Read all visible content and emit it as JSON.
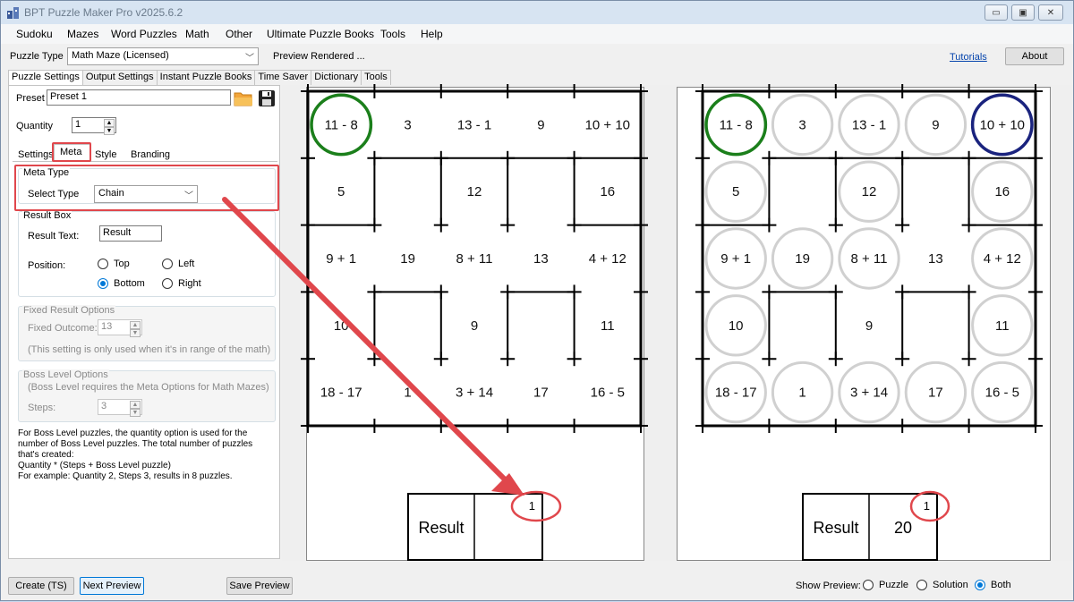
{
  "window": {
    "title": "BPT Puzzle Maker Pro v2025.6.2",
    "min": "▭",
    "max": "▣",
    "close": "✕"
  },
  "menu": [
    "Sudoku",
    "Mazes",
    "Word Puzzles",
    "Math",
    "Other",
    "Ultimate Puzzle Books",
    "Tools",
    "Help"
  ],
  "puzzle_type": {
    "label": "Puzzle Type",
    "value": "Math Maze (Licensed)",
    "status": "Preview Rendered ...",
    "tutorials": "Tutorials",
    "about": "About"
  },
  "main_tabs": [
    "Puzzle Settings",
    "Output Settings",
    "Instant Puzzle Books",
    "Time Saver",
    "Dictionary",
    "Tools"
  ],
  "preset": {
    "label": "Preset",
    "value": "Preset 1"
  },
  "quantity": {
    "label": "Quantity",
    "value": "1"
  },
  "sub_tabs": [
    "Settings",
    "Meta",
    "Style",
    "Branding"
  ],
  "meta_type": {
    "legend": "Meta Type",
    "label": "Select Type",
    "value": "Chain"
  },
  "result_box": {
    "legend": "Result Box",
    "text_label": "Result Text:",
    "text_value": "Result",
    "position_label": "Position:",
    "top": "Top",
    "left": "Left",
    "bottom": "Bottom",
    "right": "Right"
  },
  "fixed_result": {
    "legend": "Fixed Result Options",
    "label": "Fixed Outcome:",
    "value": "13",
    "note": "(This setting is only used when it's in range of the math)"
  },
  "boss_level": {
    "legend": "Boss Level Options",
    "note": "(Boss Level requires the Meta Options for Math Mazes)",
    "label": "Steps:",
    "value": "3"
  },
  "boss_help": [
    "For Boss Level puzzles, the quantity option is used for the",
    "number of Boss Level puzzles. The total number of puzzles",
    "that's created:",
    "Quantity * (Steps + Boss Level puzzle)",
    "For example: Quantity 2, Steps 3, results in 8 puzzles."
  ],
  "puzzle_cells": [
    [
      "11 - 8",
      "3",
      "13 - 1",
      "9",
      "10 + 10"
    ],
    [
      "5",
      "",
      "12",
      "",
      "16"
    ],
    [
      "9 + 1",
      "19",
      "8 + 11",
      "13",
      "4 + 12"
    ],
    [
      "10",
      "",
      "9",
      "",
      "11"
    ],
    [
      "18 - 17",
      "1",
      "3 + 14",
      "17",
      "16 - 5"
    ]
  ],
  "puzzle_result": {
    "label": "Result",
    "value": "",
    "step": "1"
  },
  "solution_result": {
    "label": "Result",
    "value": "20",
    "step": "1"
  },
  "bottom": {
    "create": "Create (TS)",
    "next_preview": "Next Preview",
    "save_preview": "Save Preview",
    "show_preview": "Show Preview:",
    "puzzle": "Puzzle",
    "solution": "Solution",
    "both": "Both"
  },
  "colors": {
    "start_circle": "#1b7f1b",
    "end_circle": "#1a237e",
    "path_circle": "#d0d0d0",
    "annotation": "#e0474c"
  }
}
